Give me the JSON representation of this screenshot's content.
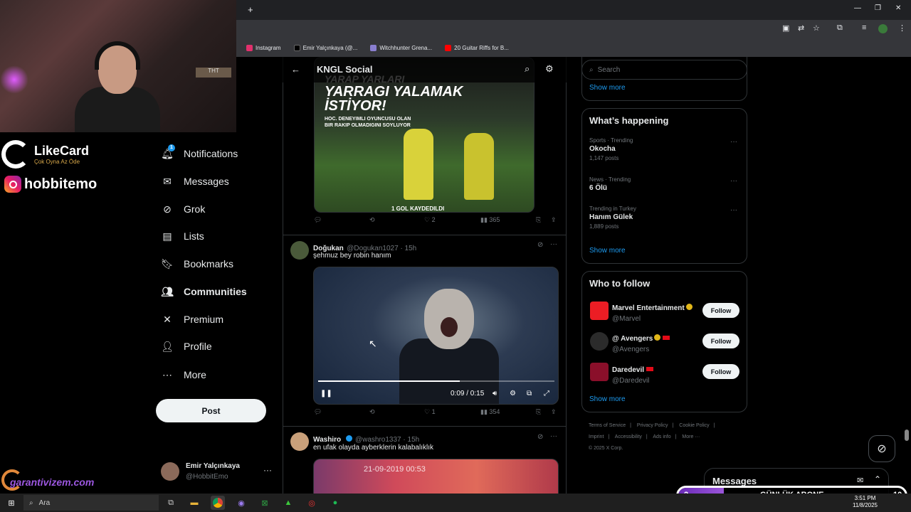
{
  "browser": {
    "new_tab": "+",
    "bookmarks": [
      {
        "label": "Instagram",
        "color": "#e1306c"
      },
      {
        "label": "Emir Yalçınkaya (@...",
        "color": "#000000"
      },
      {
        "label": "Witchhunter Grena...",
        "color": "#8a7fd0"
      },
      {
        "label": "20 Guitar Riffs for B...",
        "color": "#ff0000"
      }
    ]
  },
  "overlay": {
    "likecard_title": "LikeCard",
    "likecard_tagline": "Çok Oyna   Az Öde",
    "instagram_handle": "hobbitemo",
    "sponsor": "garantivizem.com",
    "shelf_sign": "ТНТ"
  },
  "nav": {
    "items": [
      {
        "label": "Notifications",
        "icon": "bell-icon"
      },
      {
        "label": "Messages",
        "icon": "mail-icon"
      },
      {
        "label": "Grok",
        "icon": "grok-icon"
      },
      {
        "label": "Lists",
        "icon": "list-icon"
      },
      {
        "label": "Bookmarks",
        "icon": "bookmark-icon"
      },
      {
        "label": "Communities",
        "icon": "communities-icon"
      },
      {
        "label": "Premium",
        "icon": "x-icon"
      },
      {
        "label": "Profile",
        "icon": "profile-icon"
      },
      {
        "label": "More",
        "icon": "more-icon"
      }
    ],
    "notif_badge": "1",
    "post_label": "Post",
    "account_name": "Emir Yalçınkaya",
    "account_handle": "@HobbitEmo"
  },
  "header": {
    "title": "KNGL Social"
  },
  "tweets": [
    {
      "image_caption": "YARRAGI YALAMAK İSTİYOR!",
      "image_caption_top": "YARAP YARLARI",
      "image_sub": "HOC. DENEYIMLI OYUNCUSU OLAN BIR RAKIP OLMADIGINI SOYLUYOR",
      "image_bottom": "1 GOL KAYDEDILDI",
      "likes": "2",
      "views": "365"
    },
    {
      "name": "Doğukan",
      "handle": "@Dogukan1027 · 15h",
      "text": "şehmuz bey robin hanım",
      "video_time": "0:09 / 0:15",
      "video_progress": 0.6,
      "likes": "1",
      "views": "354"
    },
    {
      "name": "Washiro",
      "handle": "@washro1337 · 15h",
      "text": "en ufak olayda ayberklerin kalabalıklık",
      "image_date": "21-09-2019 00:53"
    }
  ],
  "right": {
    "search_placeholder": "Search",
    "show_more": "Show more",
    "happening_title": "What’s happening",
    "trends": [
      {
        "meta": "Sports · Trending",
        "name": "Okocha",
        "posts": "1,147 posts"
      },
      {
        "meta": "News · Trending",
        "name": "6 Ölü",
        "posts": ""
      },
      {
        "meta": "Trending in Turkey",
        "name": "Hanım Gülek",
        "posts": "1,889 posts"
      }
    ],
    "wtf_title": "Who to follow",
    "follow_label": "Follow",
    "suggestions": [
      {
        "name": "Marvel Entertainment",
        "handle": "@Marvel",
        "avatar_color": "#ec1d24"
      },
      {
        "name": "@ Avengers",
        "handle": "@Avengers",
        "avatar_color": "#2b2b2b"
      },
      {
        "name": "Daredevil",
        "handle": "@Daredevil",
        "avatar_color": "#8a0f2a"
      }
    ],
    "footer": [
      "Terms of Service",
      "|",
      "Privacy Policy",
      "|",
      "Cookie Policy",
      "|",
      "Imprint",
      "|",
      "Accessibility",
      "|",
      "Ads info",
      "|",
      "More ···",
      "© 2025 X Corp."
    ],
    "messages_title": "Messages"
  },
  "stream": {
    "sub_count": "2",
    "sub_label": "GÜNLÜK ABONE",
    "sub_goal": "10"
  },
  "taskbar": {
    "search_placeholder": "Ara",
    "time": "3:51 PM",
    "date": "11/8/2025"
  }
}
